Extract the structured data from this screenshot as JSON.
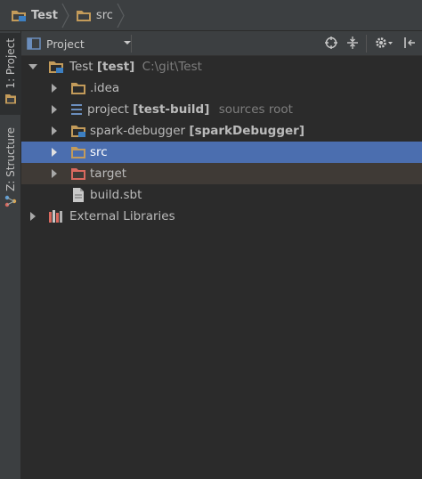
{
  "breadcrumb": {
    "items": [
      {
        "label": "Test",
        "icon": "module-folder-icon"
      },
      {
        "label": "src",
        "icon": "folder-icon"
      }
    ]
  },
  "side_tabs": [
    {
      "label": "1: Project",
      "icon": "project-icon",
      "active": true
    },
    {
      "label": "Z: Structure",
      "icon": "structure-icon",
      "active": false
    }
  ],
  "toolbar": {
    "view_label": "Project",
    "icons": [
      "scroll-from-source-icon",
      "collapse-all-icon",
      "settings-icon",
      "hide-panel-icon"
    ]
  },
  "tree": {
    "root": {
      "name": "Test",
      "module": "[test]",
      "path": "C:\\git\\Test"
    },
    "idea": {
      "name": ".idea"
    },
    "project": {
      "name": "project",
      "module": "[test-build]",
      "note": "sources root"
    },
    "spark": {
      "name": "spark-debugger",
      "module": "[sparkDebugger]"
    },
    "src": {
      "name": "src"
    },
    "target": {
      "name": "target"
    },
    "build": {
      "name": "build.sbt"
    },
    "libs": {
      "name": "External Libraries"
    }
  },
  "colors": {
    "background": "#2b2b2b",
    "panel": "#3c3f41",
    "selection": "#4b6eaf",
    "excluded_row": "#3f3a36",
    "folder": "#c39b5a",
    "excluded_folder": "#d9695f",
    "source_folder": "#6b8ebd"
  }
}
